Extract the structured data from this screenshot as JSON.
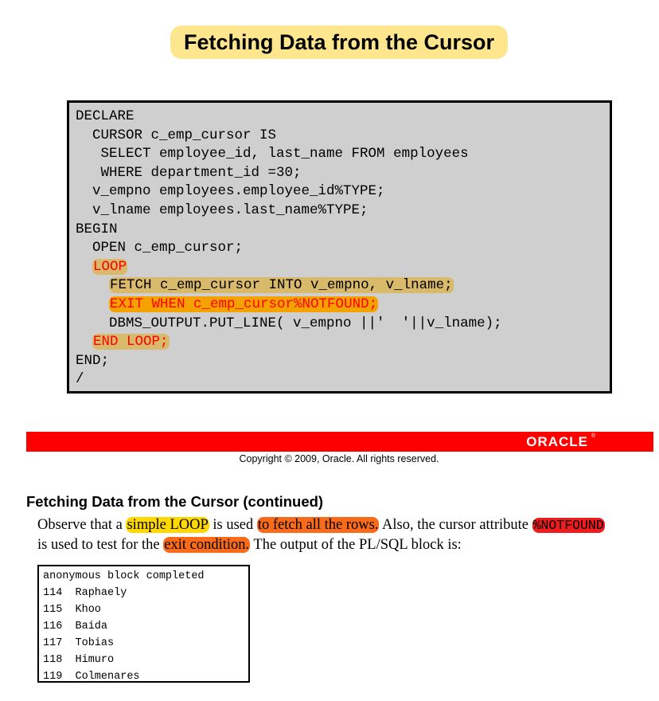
{
  "slide": {
    "title": "Fetching Data from the Cursor"
  },
  "code_block": {
    "lines": [
      {
        "plain": "DECLARE"
      },
      {
        "plain": "  CURSOR c_emp_cursor IS"
      },
      {
        "plain": "   SELECT employee_id, last_name FROM employees"
      },
      {
        "plain": "   WHERE department_id =30;"
      },
      {
        "plain": "  v_empno employees.employee_id%TYPE;"
      },
      {
        "plain": "  v_lname employees.last_name%TYPE;"
      },
      {
        "plain": "BEGIN"
      },
      {
        "plain": "  OPEN c_emp_cursor;"
      },
      {
        "indent": "  ",
        "highlighted": "LOOP"
      },
      {
        "indent": "    ",
        "highlighted": "FETCH c_emp_cursor INTO v_empno, v_lname;"
      },
      {
        "indent": "    ",
        "highlighted": "EXIT WHEN c_emp_cursor%NOTFOUND;"
      },
      {
        "plain": "    DBMS_OUTPUT.PUT_LINE( v_empno ||'  '||v_lname);"
      },
      {
        "indent": "  ",
        "highlighted": "END LOOP;"
      },
      {
        "plain": "END;"
      },
      {
        "plain": "/"
      }
    ]
  },
  "footer": {
    "logo": "ORACLE",
    "logo_mark": "®",
    "copyright": "Copyright © 2009, Oracle. All rights reserved."
  },
  "notes": {
    "heading": "Fetching Data from the Cursor (continued)",
    "line1": {
      "t1": "Observe that a ",
      "h1": "simple LOOP",
      "t2": " is used ",
      "h2": "to fetch all the rows.",
      "t3": " Also, the cursor attribute ",
      "h3": "%NOTFOUND"
    },
    "line2": {
      "t1": "is used to test for the ",
      "h1": "exit condition.",
      "t2": " The output of the PL/SQL block is:"
    }
  },
  "output": {
    "lines": [
      "anonymous block completed",
      "114  Raphaely",
      "115  Khoo",
      "116  Baida",
      "117  Tobias",
      "118  Himuro",
      "119  Colmenares"
    ]
  },
  "colors": {
    "title_highlight": "#fde68e",
    "code_background": "#cfcfcf",
    "code_highlight": "#d9b96a",
    "exit_highlight": "#f5a100",
    "keyword_red": "#ff0000",
    "footer_bar": "#ff0000",
    "note_yellow": "#ffd800",
    "note_orange": "#f96a1a",
    "note_red": "#ee1c1c"
  }
}
